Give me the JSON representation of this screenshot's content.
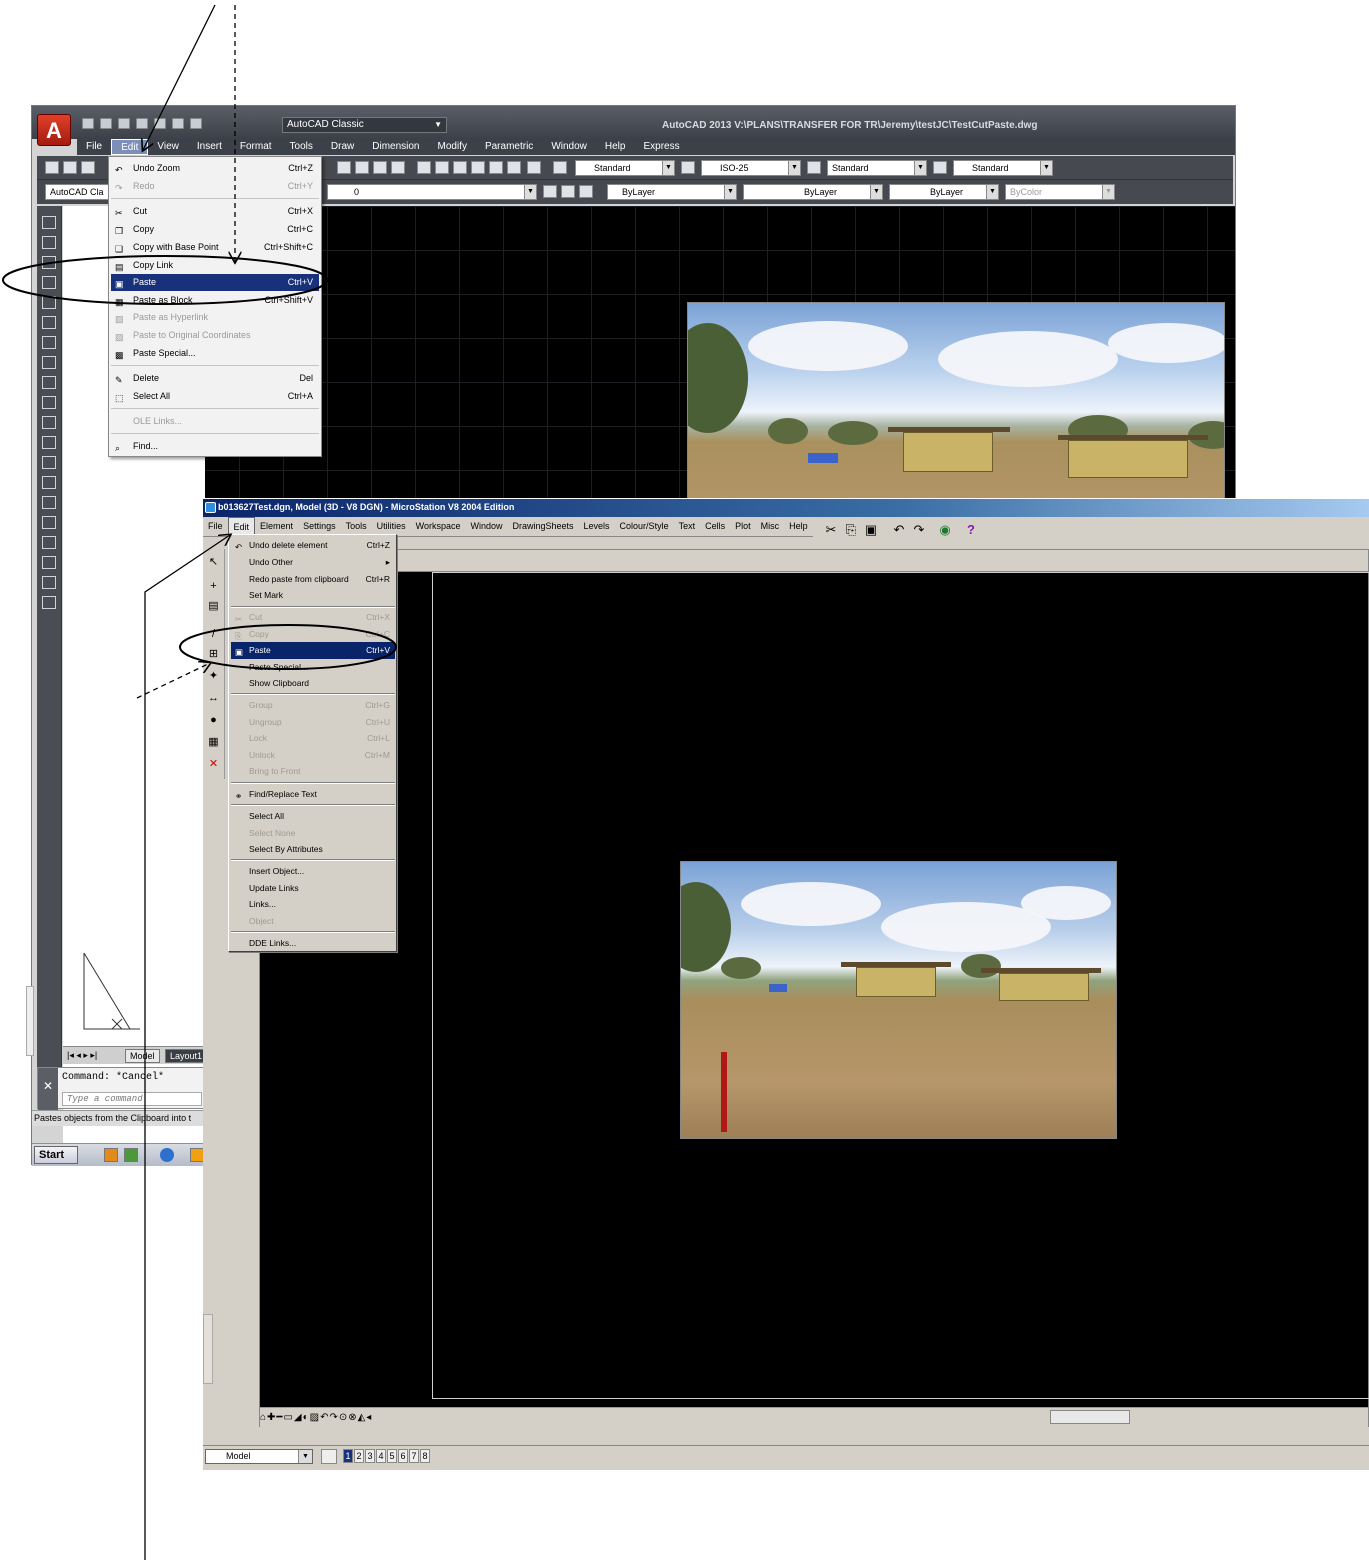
{
  "autocad": {
    "title": "AutoCAD 2013   V:\\PLANS\\TRANSFER FOR TR\\Jeremy\\testJC\\TestCutPaste.dwg",
    "logo": "A",
    "workspace": "AutoCAD Classic",
    "menu": [
      "File",
      "Edit",
      "View",
      "Insert",
      "Format",
      "Tools",
      "Draw",
      "Dimension",
      "Modify",
      "Parametric",
      "Window",
      "Help",
      "Express"
    ],
    "styles": {
      "text_style": "Standard",
      "dim_style": "ISO-25",
      "table_style": "Standard",
      "mleader_style": "Standard"
    },
    "workspace_combo": "AutoCAD Cla",
    "layer": "0",
    "color": "ByLayer",
    "linetype": "ByLayer",
    "lineweight": "ByLayer",
    "plotstyle": "ByColor",
    "edit_menu": [
      {
        "label": "Undo Zoom",
        "shortcut": "Ctrl+Z",
        "icon": "undo-icon"
      },
      {
        "label": "Redo",
        "shortcut": "Ctrl+Y",
        "icon": "redo-icon"
      },
      {
        "label": "Cut",
        "shortcut": "Ctrl+X",
        "icon": "scissors-icon"
      },
      {
        "label": "Copy",
        "shortcut": "Ctrl+C",
        "icon": "copy-icon"
      },
      {
        "label": "Copy with Base Point",
        "shortcut": "Ctrl+Shift+C",
        "icon": "copy-base-icon"
      },
      {
        "label": "Copy Link",
        "shortcut": "",
        "icon": "copy-link-icon"
      },
      {
        "label": "Paste",
        "shortcut": "Ctrl+V",
        "icon": "paste-icon"
      },
      {
        "label": "Paste as Block",
        "shortcut": "Ctrl+Shift+V",
        "icon": "paste-block-icon"
      },
      {
        "label": "Paste as Hyperlink",
        "shortcut": "",
        "icon": "paste-hyperlink-icon"
      },
      {
        "label": "Paste to Original Coordinates",
        "shortcut": "",
        "icon": "paste-original-icon"
      },
      {
        "label": "Paste Special...",
        "shortcut": "",
        "icon": "paste-special-icon"
      },
      {
        "label": "Delete",
        "shortcut": "Del",
        "icon": "eraser-icon"
      },
      {
        "label": "Select All",
        "shortcut": "Ctrl+A",
        "icon": "select-all-icon"
      },
      {
        "label": "OLE Links...",
        "shortcut": "",
        "icon": ""
      },
      {
        "label": "Find...",
        "shortcut": "",
        "icon": "find-icon"
      }
    ],
    "layout_tabs": [
      "Model",
      "Layout1"
    ],
    "command_history": "Command: *Cancel*",
    "command_prompt": "Type a command",
    "status_text": "Pastes objects from the Clipboard into t",
    "start_label": "Start"
  },
  "microstation": {
    "title": "b013627Test.dgn, Model (3D - V8 DGN) - MicroStation V8 2004 Edition",
    "menu": [
      "File",
      "Edit",
      "Element",
      "Settings",
      "Tools",
      "Utilities",
      "Workspace",
      "Window",
      "DrawingSheets",
      "Levels",
      "Colour/Style",
      "Text",
      "Cells",
      "Plot",
      "Misc",
      "Help"
    ],
    "edit_menu": [
      {
        "label": "Undo delete element",
        "shortcut": "Ctrl+Z"
      },
      {
        "label": "Undo Other",
        "shortcut": "▸"
      },
      {
        "label": "Redo paste from clipboard",
        "shortcut": "Ctrl+R"
      },
      {
        "label": "Set Mark",
        "shortcut": ""
      },
      {
        "label": "Cut",
        "shortcut": "Ctrl+X"
      },
      {
        "label": "Copy",
        "shortcut": "Ctrl+C"
      },
      {
        "label": "Paste",
        "shortcut": "Ctrl+V"
      },
      {
        "label": "Paste Special...",
        "shortcut": ""
      },
      {
        "label": "Show Clipboard",
        "shortcut": ""
      },
      {
        "label": "Group",
        "shortcut": "Ctrl+G"
      },
      {
        "label": "Ungroup",
        "shortcut": "Ctrl+U"
      },
      {
        "label": "Lock",
        "shortcut": "Ctrl+L"
      },
      {
        "label": "Unlock",
        "shortcut": "Ctrl+M"
      },
      {
        "label": "Bring to Front",
        "shortcut": ""
      },
      {
        "label": "Find/Replace Text",
        "shortcut": ""
      },
      {
        "label": "Select All",
        "shortcut": ""
      },
      {
        "label": "Select None",
        "shortcut": ""
      },
      {
        "label": "Select By Attributes",
        "shortcut": ""
      },
      {
        "label": "Insert Object...",
        "shortcut": ""
      },
      {
        "label": "Update Links",
        "shortcut": ""
      },
      {
        "label": "Links...",
        "shortcut": ""
      },
      {
        "label": "Object",
        "shortcut": ""
      },
      {
        "label": "DDE Links...",
        "shortcut": ""
      }
    ],
    "model_selector": "Model",
    "view_numbers": [
      "1",
      "2",
      "3",
      "4",
      "5",
      "6",
      "7",
      "8"
    ],
    "help_glyph": "?"
  }
}
